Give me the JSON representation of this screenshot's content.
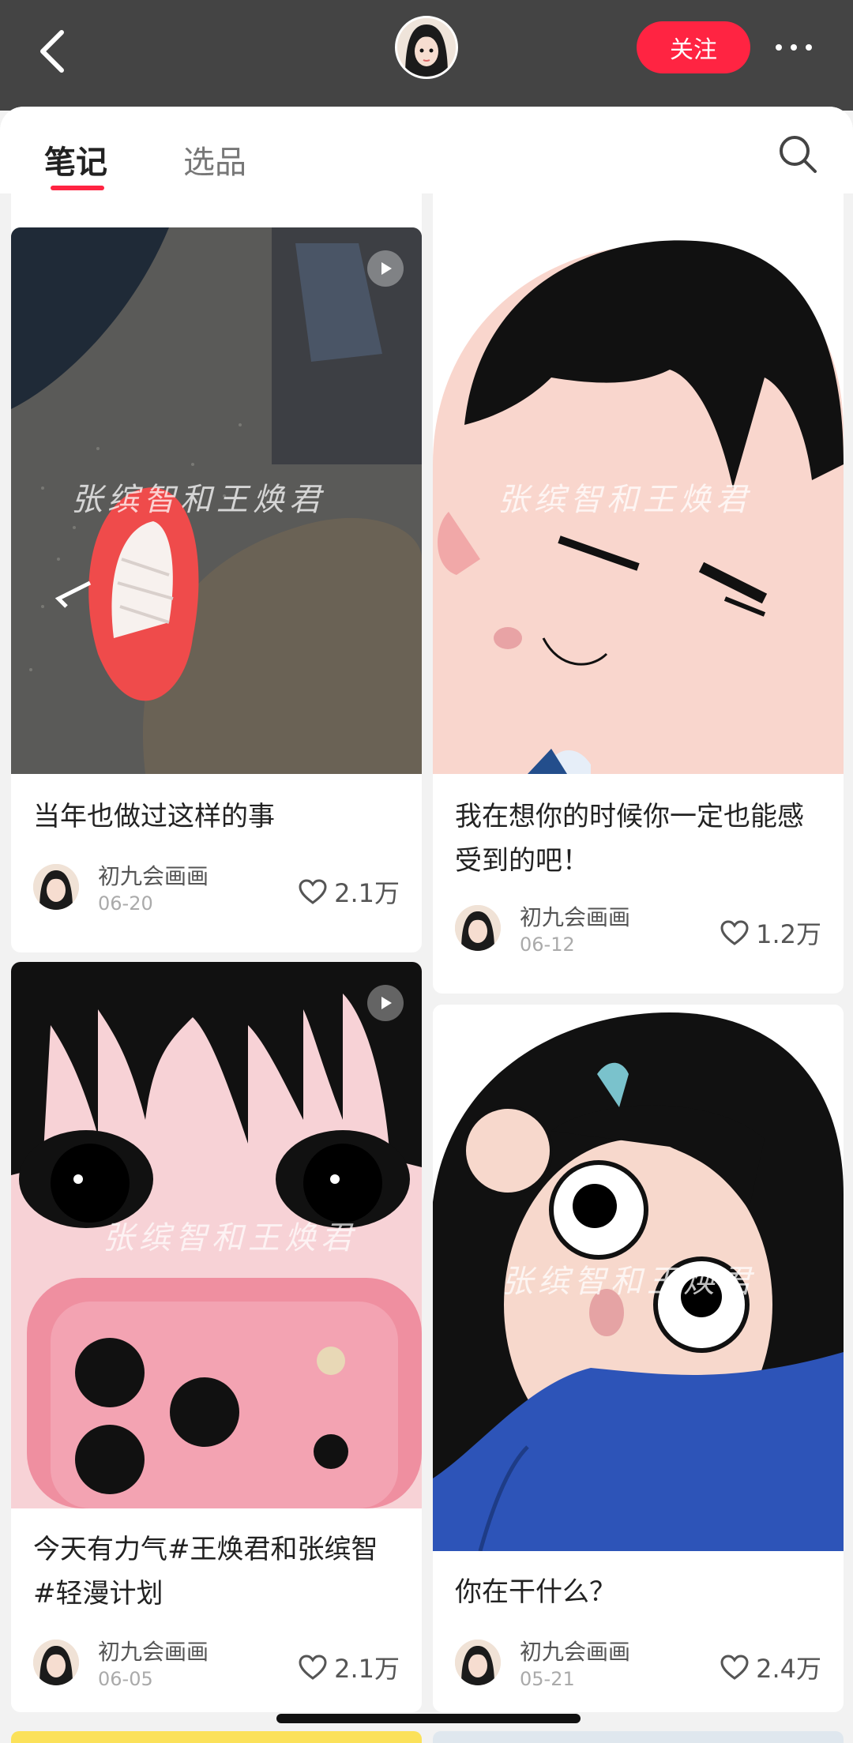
{
  "header": {
    "follow_label": "关注"
  },
  "tabs": [
    {
      "label": "笔记",
      "active": true
    },
    {
      "label": "选品",
      "active": false
    }
  ],
  "notes": [
    {
      "title": "当年也做过这样的事",
      "author": "初九会画画",
      "date": "06-20",
      "likes": "2.1万",
      "watermark": "张缤智和王焕君",
      "is_video": true
    },
    {
      "title": "我在想你的时候你一定也能感受到的吧！",
      "author": "初九会画画",
      "date": "06-12",
      "likes": "1.2万",
      "watermark": "张缤智和王焕君",
      "is_video": true
    },
    {
      "title": "今天有力气#王焕君和张缤智 #轻漫计划",
      "author": "初九会画画",
      "date": "06-05",
      "likes": "2.1万",
      "watermark": "张缤智和王焕君",
      "is_video": true
    },
    {
      "title": "你在干什么？",
      "author": "初九会画画",
      "date": "05-21",
      "likes": "2.4万",
      "watermark": "张缤智和王焕君",
      "is_video": true
    }
  ],
  "colors": {
    "accent": "#ff2442",
    "topbar": "#444444"
  },
  "icons": [
    "back-icon",
    "more-icon",
    "search-icon",
    "play-icon",
    "heart-icon"
  ]
}
